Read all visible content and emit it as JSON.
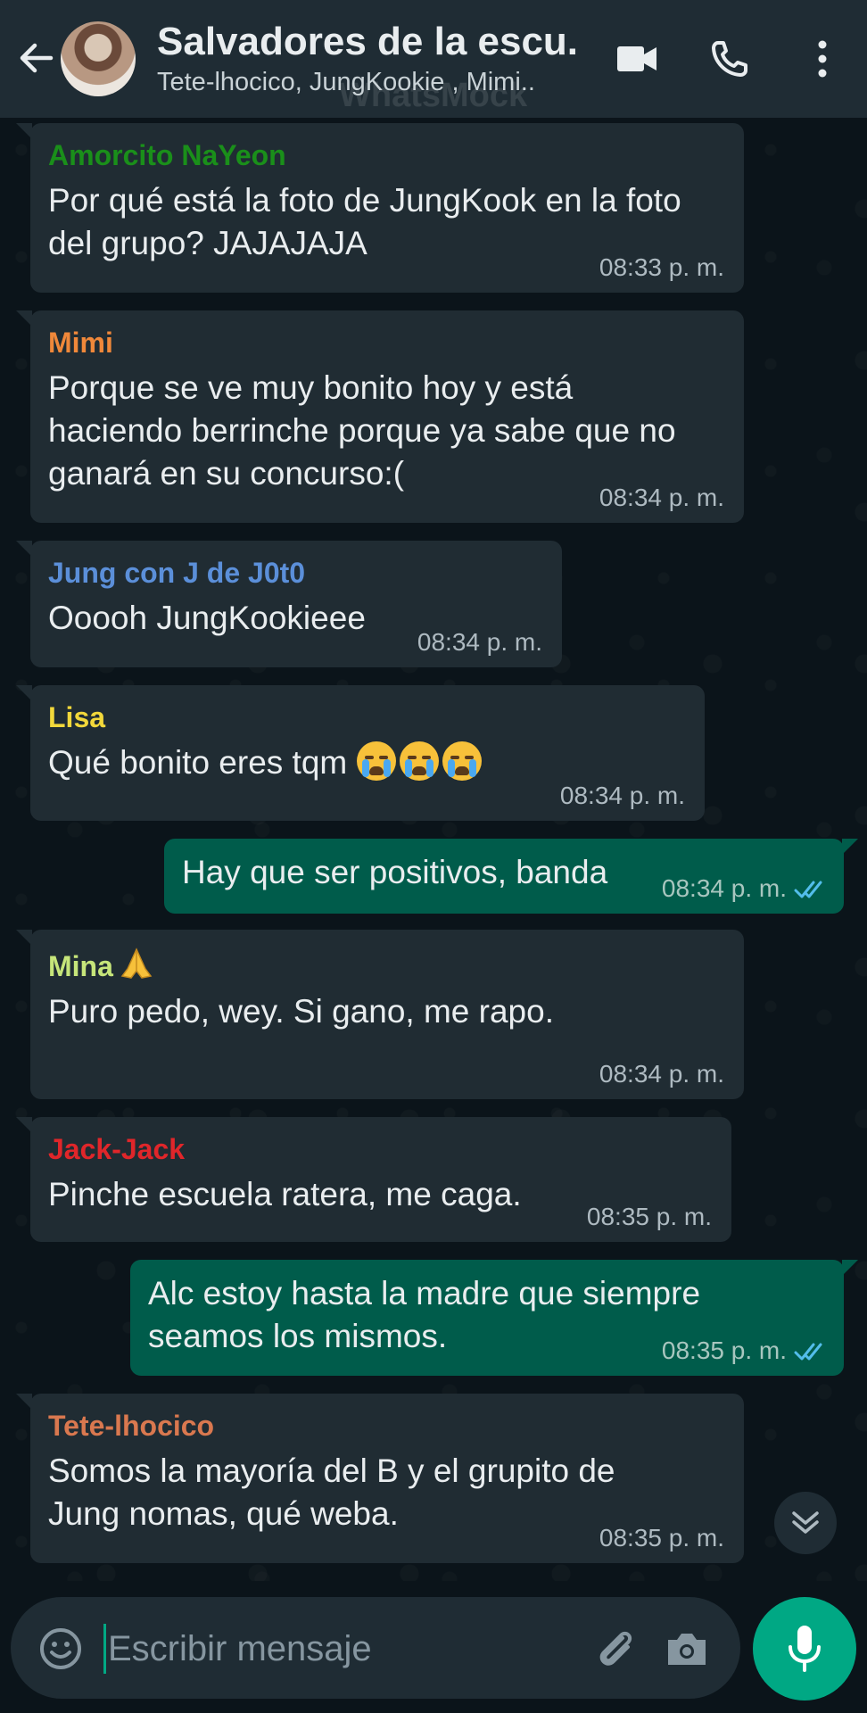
{
  "header": {
    "title": "Salvadores de la escu...",
    "subtitle": "Tete-lhocico, JungKookie , Mimi..",
    "watermark": "WhatsMock"
  },
  "messages": [
    {
      "direction": "in",
      "sender": "Amorcito NaYeon",
      "sender_color": "#1a8f1a",
      "text": "Por qué está la foto de JungKook en la foto del grupo? JAJAJAJA",
      "time": "08:33 p. m."
    },
    {
      "direction": "in",
      "sender": "Mimi",
      "sender_color": "#f0883a",
      "text": "Porque se ve muy bonito hoy y está haciendo berrinche porque ya sabe que no ganará en su concurso:(",
      "time": "08:34 p. m."
    },
    {
      "direction": "in",
      "sender": "Jung con J de J0t0",
      "sender_color": "#5b8fd9",
      "text": "Ooooh JungKookieee",
      "time": "08:34 p. m."
    },
    {
      "direction": "in",
      "sender": "Lisa",
      "sender_color": "#f2d83b",
      "text": "Qué bonito eres tqm",
      "time": "08:34 p. m."
    },
    {
      "direction": "out",
      "text": "Hay que ser positivos, banda",
      "time": "08:34 p. m."
    },
    {
      "direction": "in",
      "sender": "Mina",
      "sender_color": "#c6e57a",
      "text": "Puro pedo, wey. Si gano, me rapo.",
      "time": "08:34 p. m."
    },
    {
      "direction": "in",
      "sender": "Jack-Jack",
      "sender_color": "#e0262a",
      "text": "Pinche escuela ratera, me caga.",
      "time": "08:35 p. m."
    },
    {
      "direction": "out",
      "text": "Alc estoy hasta la madre que siempre seamos los mismos.",
      "time": "08:35 p. m."
    },
    {
      "direction": "in",
      "sender": "Tete-lhocico",
      "sender_color": "#d9784f",
      "text": "Somos la mayoría del B y el grupito de Jung nomas, qué weba.",
      "time": "08:35 p. m."
    }
  ],
  "input": {
    "placeholder": "Escribir mensaje"
  },
  "colors": {
    "header_bg": "#1f2c34",
    "incoming_bubble": "#202c33",
    "outgoing_bubble": "#005c4b",
    "accent": "#00a884",
    "read_ticks": "#53bdeb"
  }
}
